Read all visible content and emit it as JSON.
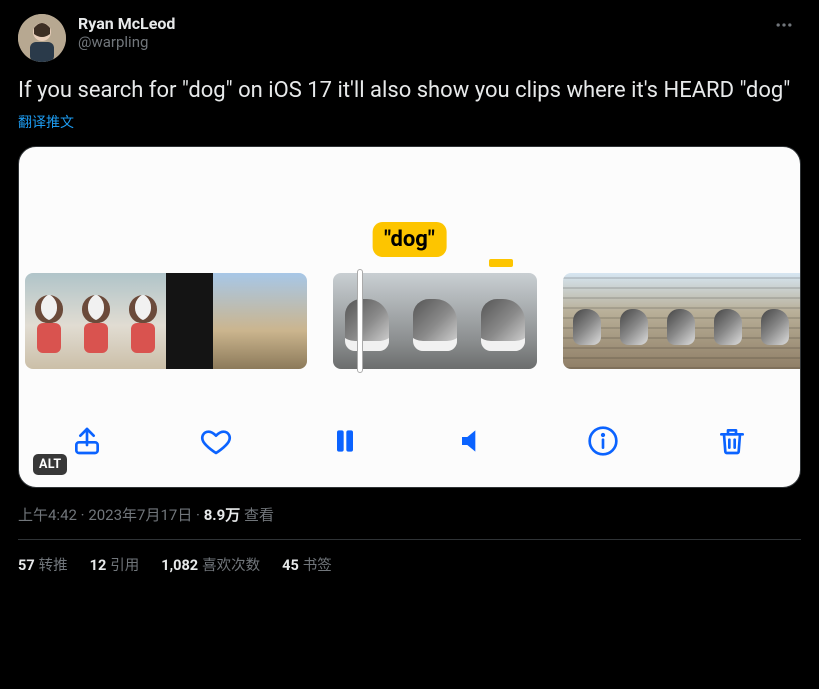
{
  "user": {
    "display_name": "Ryan McLeod",
    "handle": "@warpling"
  },
  "tweet_text": "If you search for \"dog\" on iOS 17 it'll also show you clips where it's HEARD \"dog\"",
  "translate_label": "翻译推文",
  "media": {
    "search_term": "\"dog\"",
    "alt_badge": "ALT"
  },
  "meta": {
    "time": "上午4:42",
    "date": "2023年7月17日",
    "views_count": "8.9万",
    "views_label": "查看",
    "separator": " · "
  },
  "engagement": [
    {
      "count": "57",
      "label": "转推"
    },
    {
      "count": "12",
      "label": "引用"
    },
    {
      "count": "1,082",
      "label": "喜欢次数"
    },
    {
      "count": "45",
      "label": "书签"
    }
  ]
}
